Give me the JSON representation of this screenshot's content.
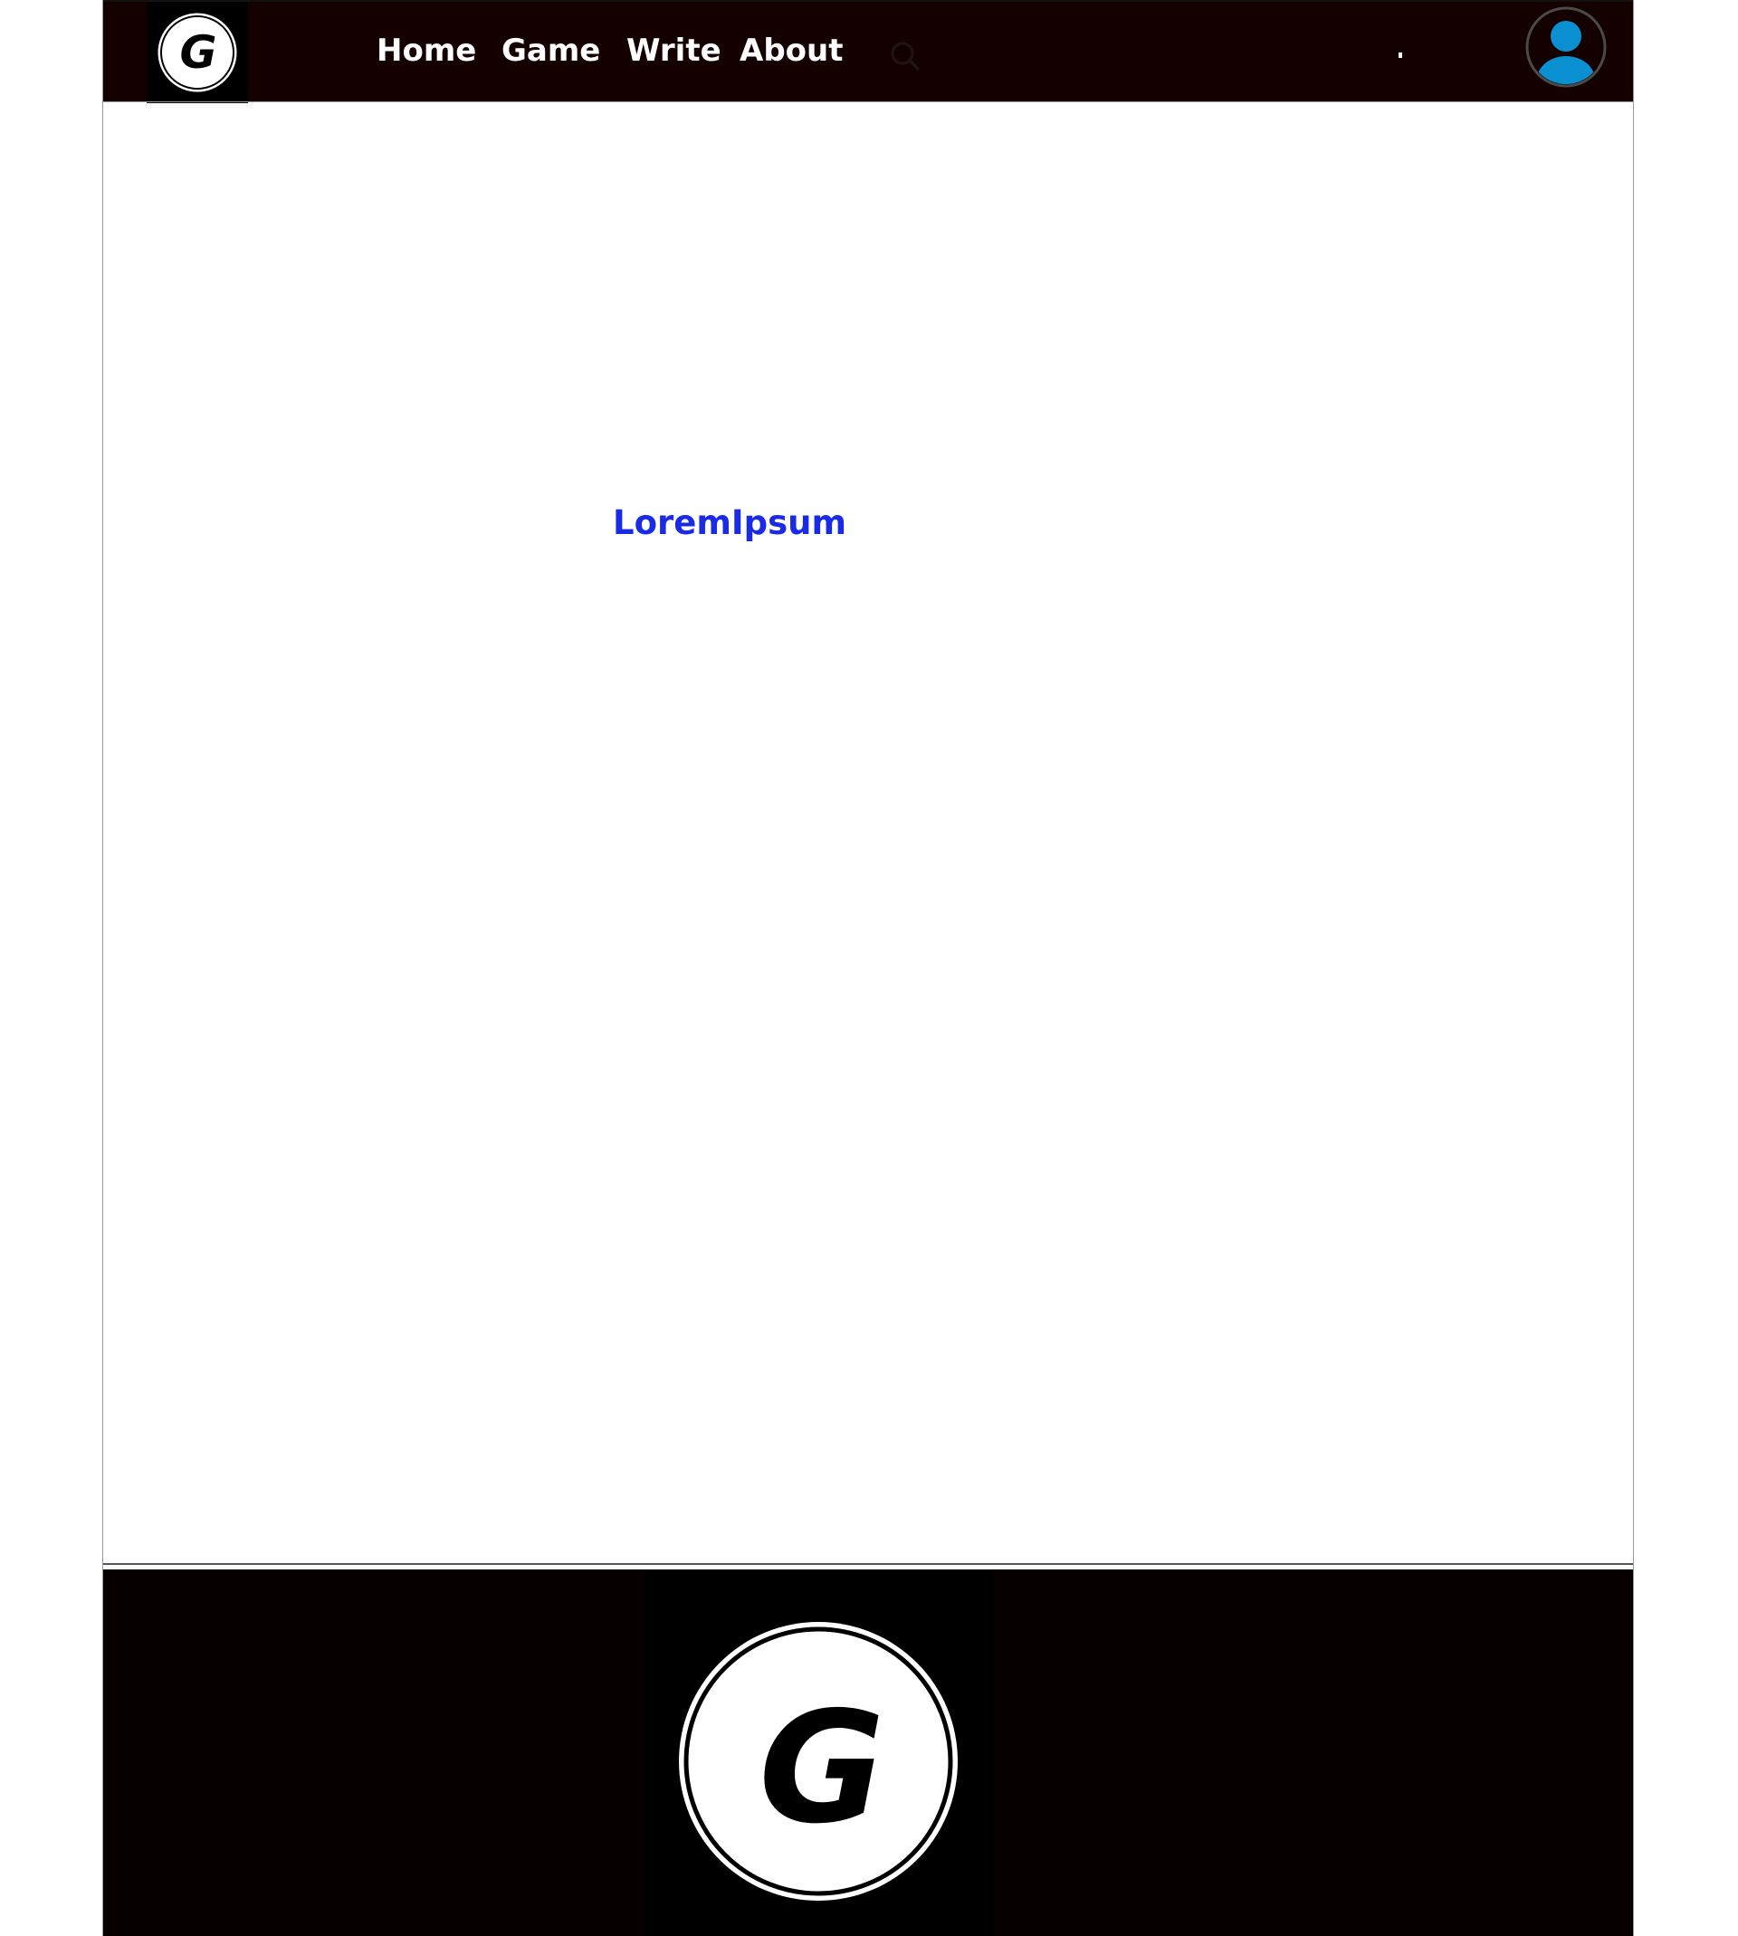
{
  "header": {
    "logo_letter": "G",
    "nav": [
      {
        "label": "Home"
      },
      {
        "label": "Game"
      },
      {
        "label": "Write"
      },
      {
        "label": "About"
      }
    ],
    "search_icon": "search-icon",
    "avatar_icon": "user-avatar-icon"
  },
  "main": {
    "link_text": "LoremIpsum"
  },
  "footer": {
    "logo_letter": "G"
  },
  "colors": {
    "header_bg": "#150000",
    "footer_bg": "#070000",
    "link": "#1a2be6",
    "avatar": "#0a8fd0"
  }
}
